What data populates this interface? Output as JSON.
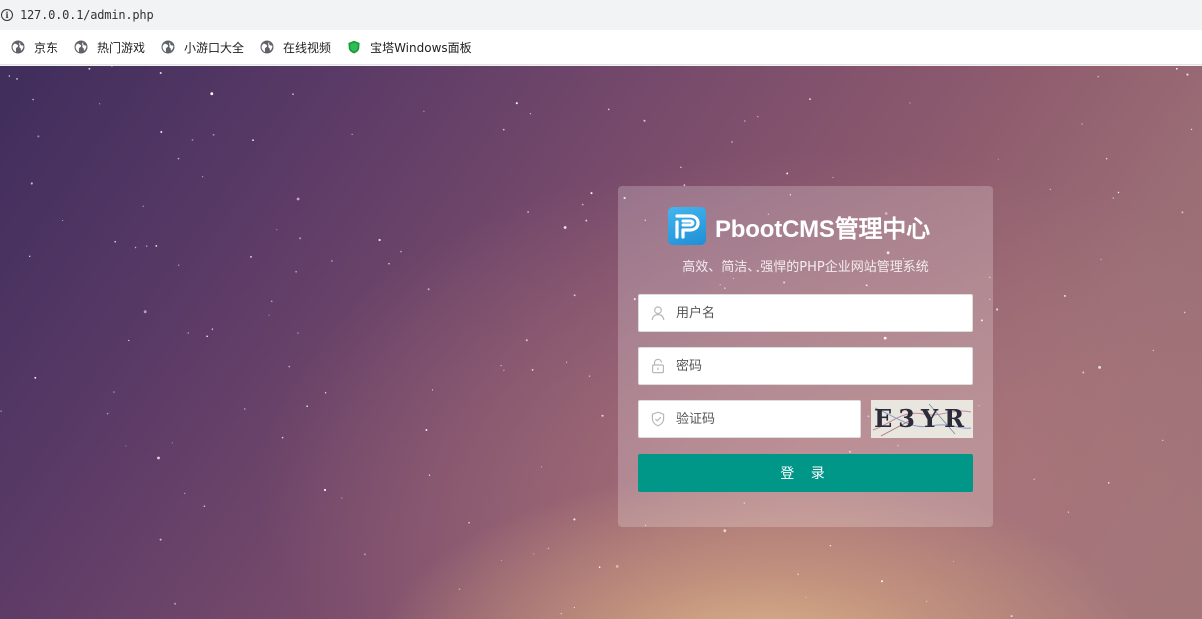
{
  "browser": {
    "url": "127.0.0.1/admin.php",
    "bookmarks": [
      {
        "label": "京东",
        "icon": "globe-icon"
      },
      {
        "label": "热门游戏",
        "icon": "globe-icon"
      },
      {
        "label": "小游口大全",
        "icon": "globe-icon"
      },
      {
        "label": "在线视频",
        "icon": "globe-icon"
      },
      {
        "label": "宝塔Windows面板",
        "icon": "bt-panel-icon"
      }
    ]
  },
  "login": {
    "title": "PbootCMS管理中心",
    "subtitle": "高效、简洁、强悍的PHP企业网站管理系统",
    "username_placeholder": "用户名",
    "password_placeholder": "密码",
    "captcha_placeholder": "验证码",
    "captcha_code": "E3YR",
    "submit_label": "登 录"
  },
  "colors": {
    "primary_button": "#009688",
    "logo": "#2b9be0"
  }
}
